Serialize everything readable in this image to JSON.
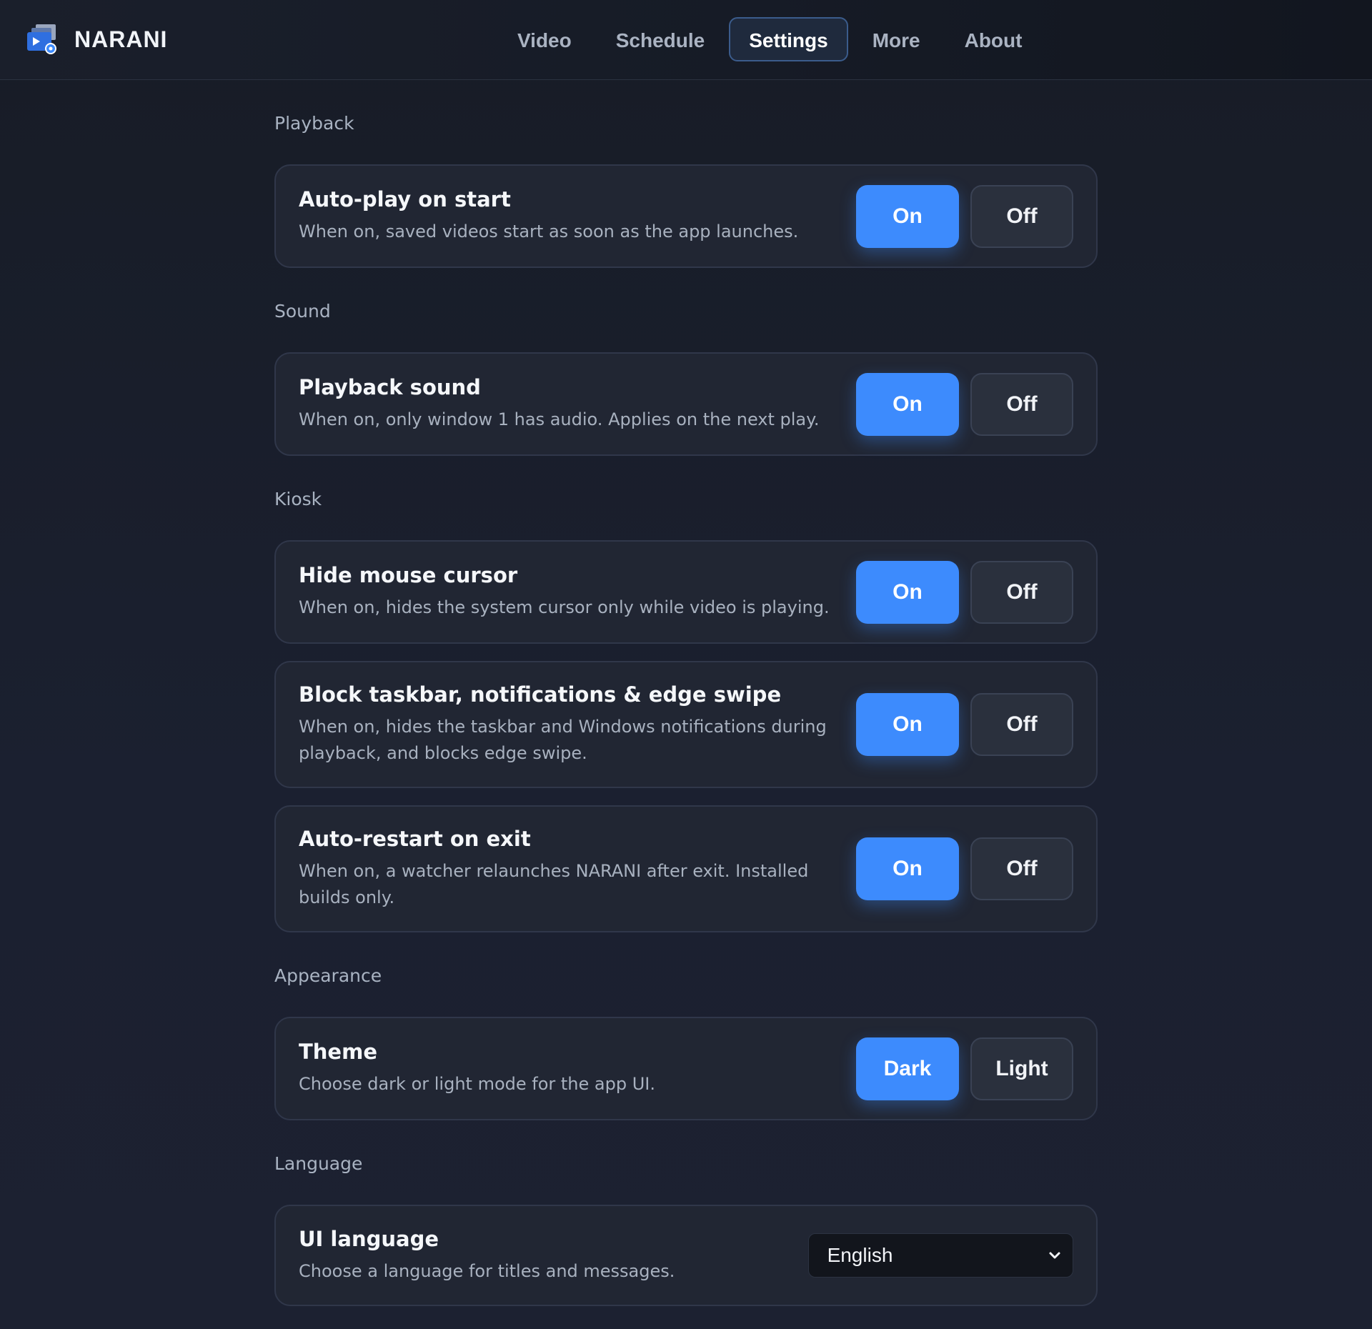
{
  "app": {
    "name": "NARANI"
  },
  "nav": {
    "tabs": [
      {
        "label": "Video"
      },
      {
        "label": "Schedule"
      },
      {
        "label": "Settings",
        "active": true
      },
      {
        "label": "More"
      },
      {
        "label": "About"
      }
    ]
  },
  "colors": {
    "accent": "#3d8bfd",
    "card_bg": "#212633",
    "page_bg": "#1a1f2b"
  },
  "sections": {
    "playback": {
      "title": "Playback",
      "autoplay": {
        "title": "Auto-play on start",
        "desc": "When on, saved videos start as soon as the app launches.",
        "on_label": "On",
        "off_label": "Off",
        "selected": "On"
      }
    },
    "sound": {
      "title": "Sound",
      "playback_sound": {
        "title": "Playback sound",
        "desc": "When on, only window 1 has audio. Applies on the next play.",
        "on_label": "On",
        "off_label": "Off",
        "selected": "On"
      }
    },
    "kiosk": {
      "title": "Kiosk",
      "hide_cursor": {
        "title": "Hide mouse cursor",
        "desc": "When on, hides the system cursor only while video is playing.",
        "on_label": "On",
        "off_label": "Off",
        "selected": "On"
      },
      "block_taskbar": {
        "title": "Block taskbar, notifications & edge swipe",
        "desc": "When on, hides the taskbar and Windows notifications during playback, and blocks edge swipe.",
        "on_label": "On",
        "off_label": "Off",
        "selected": "On"
      },
      "auto_restart": {
        "title": "Auto-restart on exit",
        "desc": "When on, a watcher relaunches NARANI after exit. Installed builds only.",
        "on_label": "On",
        "off_label": "Off",
        "selected": "On"
      }
    },
    "appearance": {
      "title": "Appearance",
      "theme": {
        "title": "Theme",
        "desc": "Choose dark or light mode for the app UI.",
        "dark_label": "Dark",
        "light_label": "Light",
        "selected": "Dark"
      }
    },
    "language": {
      "title": "Language",
      "ui_language": {
        "title": "UI language",
        "desc": "Choose a language for titles and messages.",
        "selected": "English"
      }
    }
  }
}
